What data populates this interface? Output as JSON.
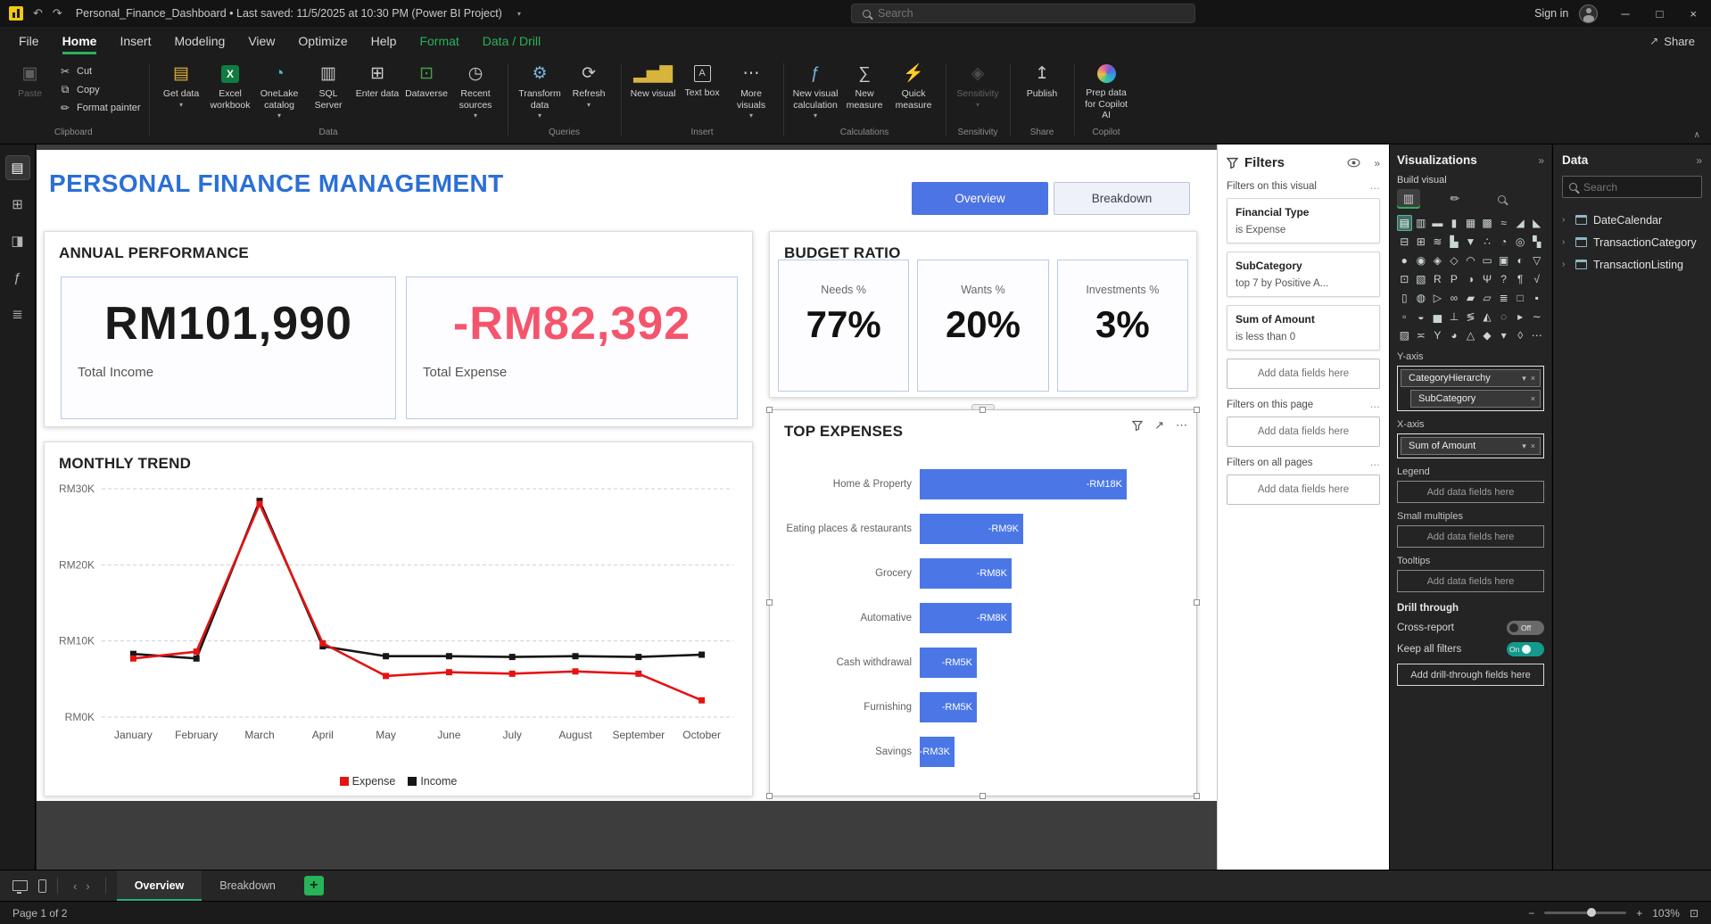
{
  "colors": {
    "accent_green": "#27b357",
    "tab_underline": "#21b08a",
    "title_blue": "#2b6fd6",
    "button_blue": "#4d74e4",
    "expense_red": "#f4556d",
    "bar_blue": "#4b77e6",
    "toggle_on": "#149a8c"
  },
  "titlebar": {
    "app_title": "Personal_Finance_Dashboard • Last saved: 11/5/2025 at 10:30 PM (Power BI Project)",
    "search_placeholder": "Search",
    "sign_in": "Sign in"
  },
  "menu": {
    "items": [
      {
        "label": "File"
      },
      {
        "label": "Home",
        "active": true
      },
      {
        "label": "Insert"
      },
      {
        "label": "Modeling"
      },
      {
        "label": "View"
      },
      {
        "label": "Optimize"
      },
      {
        "label": "Help"
      },
      {
        "label": "Format",
        "accent": true
      },
      {
        "label": "Data / Drill",
        "accent": true
      }
    ],
    "share_label": "Share"
  },
  "ribbon": {
    "groups": [
      {
        "label": "Clipboard",
        "clipboard": true,
        "items": [
          {
            "label": "Paste",
            "icon": {
              "g": "▣"
            },
            "disabled": true
          },
          {
            "label": "Cut",
            "icon": {
              "g": "✂"
            }
          },
          {
            "label": "Copy",
            "icon": {
              "g": "⧉"
            }
          },
          {
            "label": "Format painter",
            "icon": {
              "g": "✏"
            }
          }
        ]
      },
      {
        "label": "Data",
        "items": [
          {
            "label": "Get data",
            "icon": {
              "g": "▤",
              "c": "#e3b63c"
            },
            "dropdown": true
          },
          {
            "label": "Excel workbook",
            "icon": {
              "kind": "excel"
            }
          },
          {
            "label": "OneLake catalog",
            "icon": {
              "g": "◔",
              "c": "#3fc1c9"
            },
            "dropdown": true
          },
          {
            "label": "SQL Server",
            "icon": {
              "g": "▥",
              "c": "#c9c9c9"
            }
          },
          {
            "label": "Enter data",
            "icon": {
              "g": "⊞",
              "c": "#c9c9c9"
            }
          },
          {
            "label": "Dataverse",
            "icon": {
              "g": "⊡",
              "c": "#46a049"
            }
          },
          {
            "label": "Recent sources",
            "icon": {
              "g": "◷",
              "c": "#c9c9c9"
            },
            "dropdown": true
          }
        ]
      },
      {
        "label": "Queries",
        "items": [
          {
            "label": "Transform data",
            "icon": {
              "g": "⚙",
              "c": "#7fb4d8"
            },
            "dropdown": true
          },
          {
            "label": "Refresh",
            "icon": {
              "g": "⟳",
              "c": "#c9c9c9"
            },
            "dropdown": true
          }
        ]
      },
      {
        "label": "Insert",
        "items": [
          {
            "label": "New visual",
            "icon": {
              "g": "▂▅▇",
              "c": "#d8b43c"
            }
          },
          {
            "label": "Text box",
            "icon": {
              "kind": "textbox"
            }
          },
          {
            "label": "More visuals",
            "icon": {
              "g": "⋯",
              "c": "#c9c9c9"
            },
            "dropdown": true
          }
        ]
      },
      {
        "label": "Calculations",
        "items": [
          {
            "label": "New visual calculation",
            "icon": {
              "g": "ƒ",
              "c": "#7fb4d8"
            },
            "dropdown": true
          },
          {
            "label": "New measure",
            "icon": {
              "g": "∑",
              "c": "#c9c9c9"
            }
          },
          {
            "label": "Quick measure",
            "icon": {
              "g": "⚡",
              "c": "#e8c03c"
            }
          }
        ]
      },
      {
        "label": "Sensitivity",
        "items": [
          {
            "label": "Sensitivity",
            "icon": {
              "g": "◈",
              "c": "#9a9a9a"
            },
            "disabled": true,
            "dropdown": true
          }
        ]
      },
      {
        "label": "Share",
        "items": [
          {
            "label": "Publish",
            "icon": {
              "g": "↥",
              "c": "#c9c9c9"
            }
          }
        ]
      },
      {
        "label": "Copilot",
        "items": [
          {
            "label": "Prep data for Copilot AI",
            "icon": {
              "kind": "copilot"
            }
          }
        ]
      }
    ]
  },
  "left_strip": {
    "items": [
      {
        "name": "report-view",
        "glyph": "▤",
        "active": true
      },
      {
        "name": "table-view",
        "glyph": "⊞"
      },
      {
        "name": "model-view",
        "glyph": "◨"
      },
      {
        "name": "dax-query-view",
        "glyph": "ƒ"
      },
      {
        "name": "tmdl-view",
        "glyph": "≣"
      }
    ]
  },
  "canvas": {
    "title": "PERSONAL FINANCE MANAGEMENT",
    "view_buttons": [
      {
        "label": "Overview",
        "active": true
      },
      {
        "label": "Breakdown",
        "active": false
      }
    ],
    "annual": {
      "title": "ANNUAL PERFORMANCE",
      "income": {
        "value": "RM101,990",
        "label": "Total Income"
      },
      "expense": {
        "value": "-RM82,392",
        "label": "Total Expense"
      }
    },
    "budget": {
      "title": "BUDGET RATIO",
      "tiles": [
        {
          "label": "Needs %",
          "value": "77%"
        },
        {
          "label": "Wants %",
          "value": "20%"
        },
        {
          "label": "Investments %",
          "value": "3%"
        }
      ]
    }
  },
  "chart_data": [
    {
      "id": "monthly-trend",
      "type": "line",
      "title": "MONTHLY TREND",
      "x": [
        "January",
        "February",
        "March",
        "April",
        "May",
        "June",
        "July",
        "August",
        "September",
        "October"
      ],
      "series": [
        {
          "name": "Expense",
          "color": "#e51313",
          "values": [
            7.7,
            8.6,
            28.0,
            9.7,
            5.4,
            5.9,
            5.7,
            6.0,
            5.7,
            2.2
          ]
        },
        {
          "name": "Income",
          "color": "#161616",
          "values": [
            8.3,
            7.7,
            28.4,
            9.3,
            8.0,
            8.0,
            7.9,
            8.0,
            7.9,
            8.2
          ]
        }
      ],
      "ylim": [
        0,
        30
      ],
      "yticks": [
        0,
        10,
        20,
        30
      ],
      "ytick_labels": [
        "RM0K",
        "RM10K",
        "RM20K",
        "RM30K"
      ],
      "units": "RM thousands",
      "grid": true,
      "legend_position": "bottom"
    },
    {
      "id": "top-expenses",
      "type": "bar",
      "orientation": "horizontal",
      "title": "TOP EXPENSES",
      "categories": [
        "Home & Property",
        "Eating places & restaurants",
        "Grocery",
        "Automative",
        "Cash withdrawal",
        "Furnishing",
        "Savings"
      ],
      "values": [
        -18,
        -9,
        -8,
        -8,
        -5,
        -5,
        -3
      ],
      "value_labels": [
        "-RM18K",
        "-RM9K",
        "-RM8K",
        "-RM8K",
        "-RM5K",
        "-RM5K",
        "-RM3K"
      ],
      "bar_color": "#4b77e6",
      "units": "RM thousands"
    }
  ],
  "filters_pane": {
    "title": "Filters",
    "sections": [
      {
        "title": "Filters on this visual",
        "cards": [
          {
            "field": "Financial Type",
            "condition": "is Expense"
          },
          {
            "field": "SubCategory",
            "condition": "top 7 by Positive A..."
          },
          {
            "field": "Sum of Amount",
            "condition": "is less than 0"
          }
        ],
        "placeholder": "Add data fields here"
      },
      {
        "title": "Filters on this page",
        "cards": [],
        "placeholder": "Add data fields here"
      },
      {
        "title": "Filters on all pages",
        "cards": [],
        "placeholder": "Add data fields here"
      }
    ]
  },
  "visualizations_pane": {
    "title": "Visualizations",
    "build_label": "Build visual",
    "icon_grid": {
      "selected_index": 0,
      "items": [
        {
          "name": "stacked-bar-chart",
          "glyph": "▤"
        },
        {
          "name": "stacked-column-chart",
          "glyph": "▥"
        },
        {
          "name": "clustered-bar-chart",
          "glyph": "▬"
        },
        {
          "name": "clustered-column-chart",
          "glyph": "▮"
        },
        {
          "name": "100-stacked-bar-chart",
          "glyph": "▦"
        },
        {
          "name": "100-stacked-column-chart",
          "glyph": "▩"
        },
        {
          "name": "line-chart",
          "glyph": "≈"
        },
        {
          "name": "area-chart",
          "glyph": "◢"
        },
        {
          "name": "stacked-area-chart",
          "glyph": "◣"
        },
        {
          "name": "line-and-stacked-column-chart",
          "glyph": "⊟"
        },
        {
          "name": "line-and-clustered-column-chart",
          "glyph": "⊞"
        },
        {
          "name": "ribbon-chart",
          "glyph": "≋"
        },
        {
          "name": "waterfall-chart",
          "glyph": "▙"
        },
        {
          "name": "funnel-chart",
          "glyph": "▼"
        },
        {
          "name": "scatter-chart",
          "glyph": "∴"
        },
        {
          "name": "pie-chart",
          "glyph": "◔"
        },
        {
          "name": "donut-chart",
          "glyph": "◎"
        },
        {
          "name": "treemap",
          "glyph": "▚"
        },
        {
          "name": "map",
          "glyph": "●"
        },
        {
          "name": "filled-map",
          "glyph": "◉"
        },
        {
          "name": "shape-map",
          "glyph": "◈"
        },
        {
          "name": "azure-map",
          "glyph": "◇"
        },
        {
          "name": "gauge",
          "glyph": "◠"
        },
        {
          "name": "card",
          "glyph": "▭"
        },
        {
          "name": "multi-row-card",
          "glyph": "▣"
        },
        {
          "name": "kpi",
          "glyph": "◐"
        },
        {
          "name": "slicer",
          "glyph": "▽"
        },
        {
          "name": "table",
          "glyph": "⊡"
        },
        {
          "name": "matrix",
          "glyph": "▧"
        },
        {
          "name": "r-script-visual",
          "glyph": "R"
        },
        {
          "name": "python-visual",
          "glyph": "P"
        },
        {
          "name": "key-influencers",
          "glyph": "◑"
        },
        {
          "name": "decomposition-tree",
          "glyph": "Ψ"
        },
        {
          "name": "q-and-a",
          "glyph": "?"
        },
        {
          "name": "smart-narrative",
          "glyph": "¶"
        },
        {
          "name": "metrics",
          "glyph": "√"
        },
        {
          "name": "paginated-report",
          "glyph": "▯"
        },
        {
          "name": "arcgis-map",
          "glyph": "◍"
        },
        {
          "name": "power-apps",
          "glyph": "▷"
        },
        {
          "name": "power-automate",
          "glyph": "∞"
        },
        {
          "name": "button-slicer",
          "glyph": "▰"
        },
        {
          "name": "text-slicer",
          "glyph": "▱"
        },
        {
          "name": "list-slicer",
          "glyph": "≣"
        },
        {
          "name": "new-card",
          "glyph": "□"
        },
        {
          "name": "accent-bar",
          "glyph": "▪"
        },
        {
          "name": "small-multiples-chart",
          "glyph": "▫"
        },
        {
          "name": "radial-gauge",
          "glyph": "◒"
        },
        {
          "name": "histogram",
          "glyph": "▅"
        },
        {
          "name": "box-plot",
          "glyph": "⊥"
        },
        {
          "name": "bullet-chart",
          "glyph": "≶"
        },
        {
          "name": "sankey-chart",
          "glyph": "◭"
        },
        {
          "name": "network-chart",
          "glyph": "◌"
        },
        {
          "name": "word-cloud",
          "glyph": "▸"
        },
        {
          "name": "sparkline",
          "glyph": "∼"
        },
        {
          "name": "calendar-visual",
          "glyph": "▨"
        },
        {
          "name": "timeline",
          "glyph": "≍"
        },
        {
          "name": "org-chart",
          "glyph": "Y"
        },
        {
          "name": "sunburst-chart",
          "glyph": "◕"
        },
        {
          "name": "radar-chart",
          "glyph": "△"
        },
        {
          "name": "gantt-chart",
          "glyph": "◆"
        },
        {
          "name": "heatmap",
          "glyph": "▾"
        },
        {
          "name": "tornado-chart",
          "glyph": "◊"
        },
        {
          "name": "get-more-visuals",
          "glyph": "⋯"
        }
      ]
    },
    "wells": [
      {
        "label": "Y-axis",
        "pills": [
          {
            "text": "CategoryHierarchy",
            "dropdown": true,
            "removable": true
          },
          {
            "text": "SubCategory",
            "removable": true,
            "indent": true
          }
        ]
      },
      {
        "label": "X-axis",
        "pills": [
          {
            "text": "Sum of Amount",
            "dropdown": true,
            "removable": true
          }
        ]
      },
      {
        "label": "Legend",
        "placeholder": "Add data fields here"
      },
      {
        "label": "Small multiples",
        "placeholder": "Add data fields here"
      },
      {
        "label": "Tooltips",
        "placeholder": "Add data fields here"
      }
    ],
    "drill": {
      "title": "Drill through",
      "rows": [
        {
          "label": "Cross-report",
          "state": "Off",
          "on": false
        },
        {
          "label": "Keep all filters",
          "state": "On",
          "on": true
        }
      ],
      "placeholder": "Add drill-through fields here"
    }
  },
  "data_pane": {
    "title": "Data",
    "search_placeholder": "Search",
    "tables": [
      {
        "name": "DateCalendar"
      },
      {
        "name": "TransactionCategory"
      },
      {
        "name": "TransactionListing"
      }
    ]
  },
  "tabbar": {
    "tabs": [
      {
        "label": "Overview",
        "active": true
      },
      {
        "label": "Breakdown",
        "active": false
      }
    ],
    "add_label": "+"
  },
  "statusbar": {
    "page_info": "Page 1 of 2",
    "zoom": "103%"
  }
}
